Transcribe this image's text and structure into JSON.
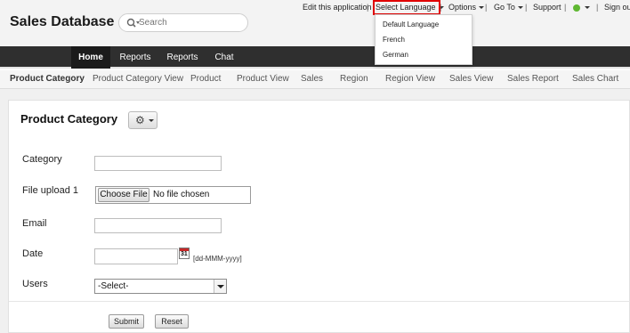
{
  "app": {
    "title": "Sales Database"
  },
  "search": {
    "placeholder": "Search"
  },
  "toplinks": {
    "edit": "Edit this application",
    "language": "Select Language",
    "options": "Options",
    "goto": "Go To",
    "support": "Support",
    "signout": "Sign out"
  },
  "language_menu": [
    "Default Language",
    "French",
    "German"
  ],
  "nav": {
    "items": [
      "Home",
      "Reports",
      "Reports",
      "Chat"
    ],
    "active": "Home"
  },
  "subtabs": [
    "Product Category",
    "Product Category View",
    "Product",
    "Product View",
    "Sales",
    "Region",
    "Region View",
    "Sales View",
    "Sales Report",
    "Sales Chart"
  ],
  "form": {
    "title": "Product Category",
    "fields": {
      "category_label": "Category",
      "file_label": "File upload 1",
      "file_button": "Choose File",
      "file_status": "No file chosen",
      "email_label": "Email",
      "date_label": "Date",
      "date_hint": "[dd-MMM-yyyy]",
      "calendar_day": "31",
      "users_label": "Users",
      "users_selected": "-Select-"
    },
    "buttons": {
      "submit": "Submit",
      "reset": "Reset"
    }
  },
  "colors": {
    "highlight": "#e00000",
    "nav_bg": "#2f2f2f",
    "nav_active": "#1b1b1b"
  }
}
